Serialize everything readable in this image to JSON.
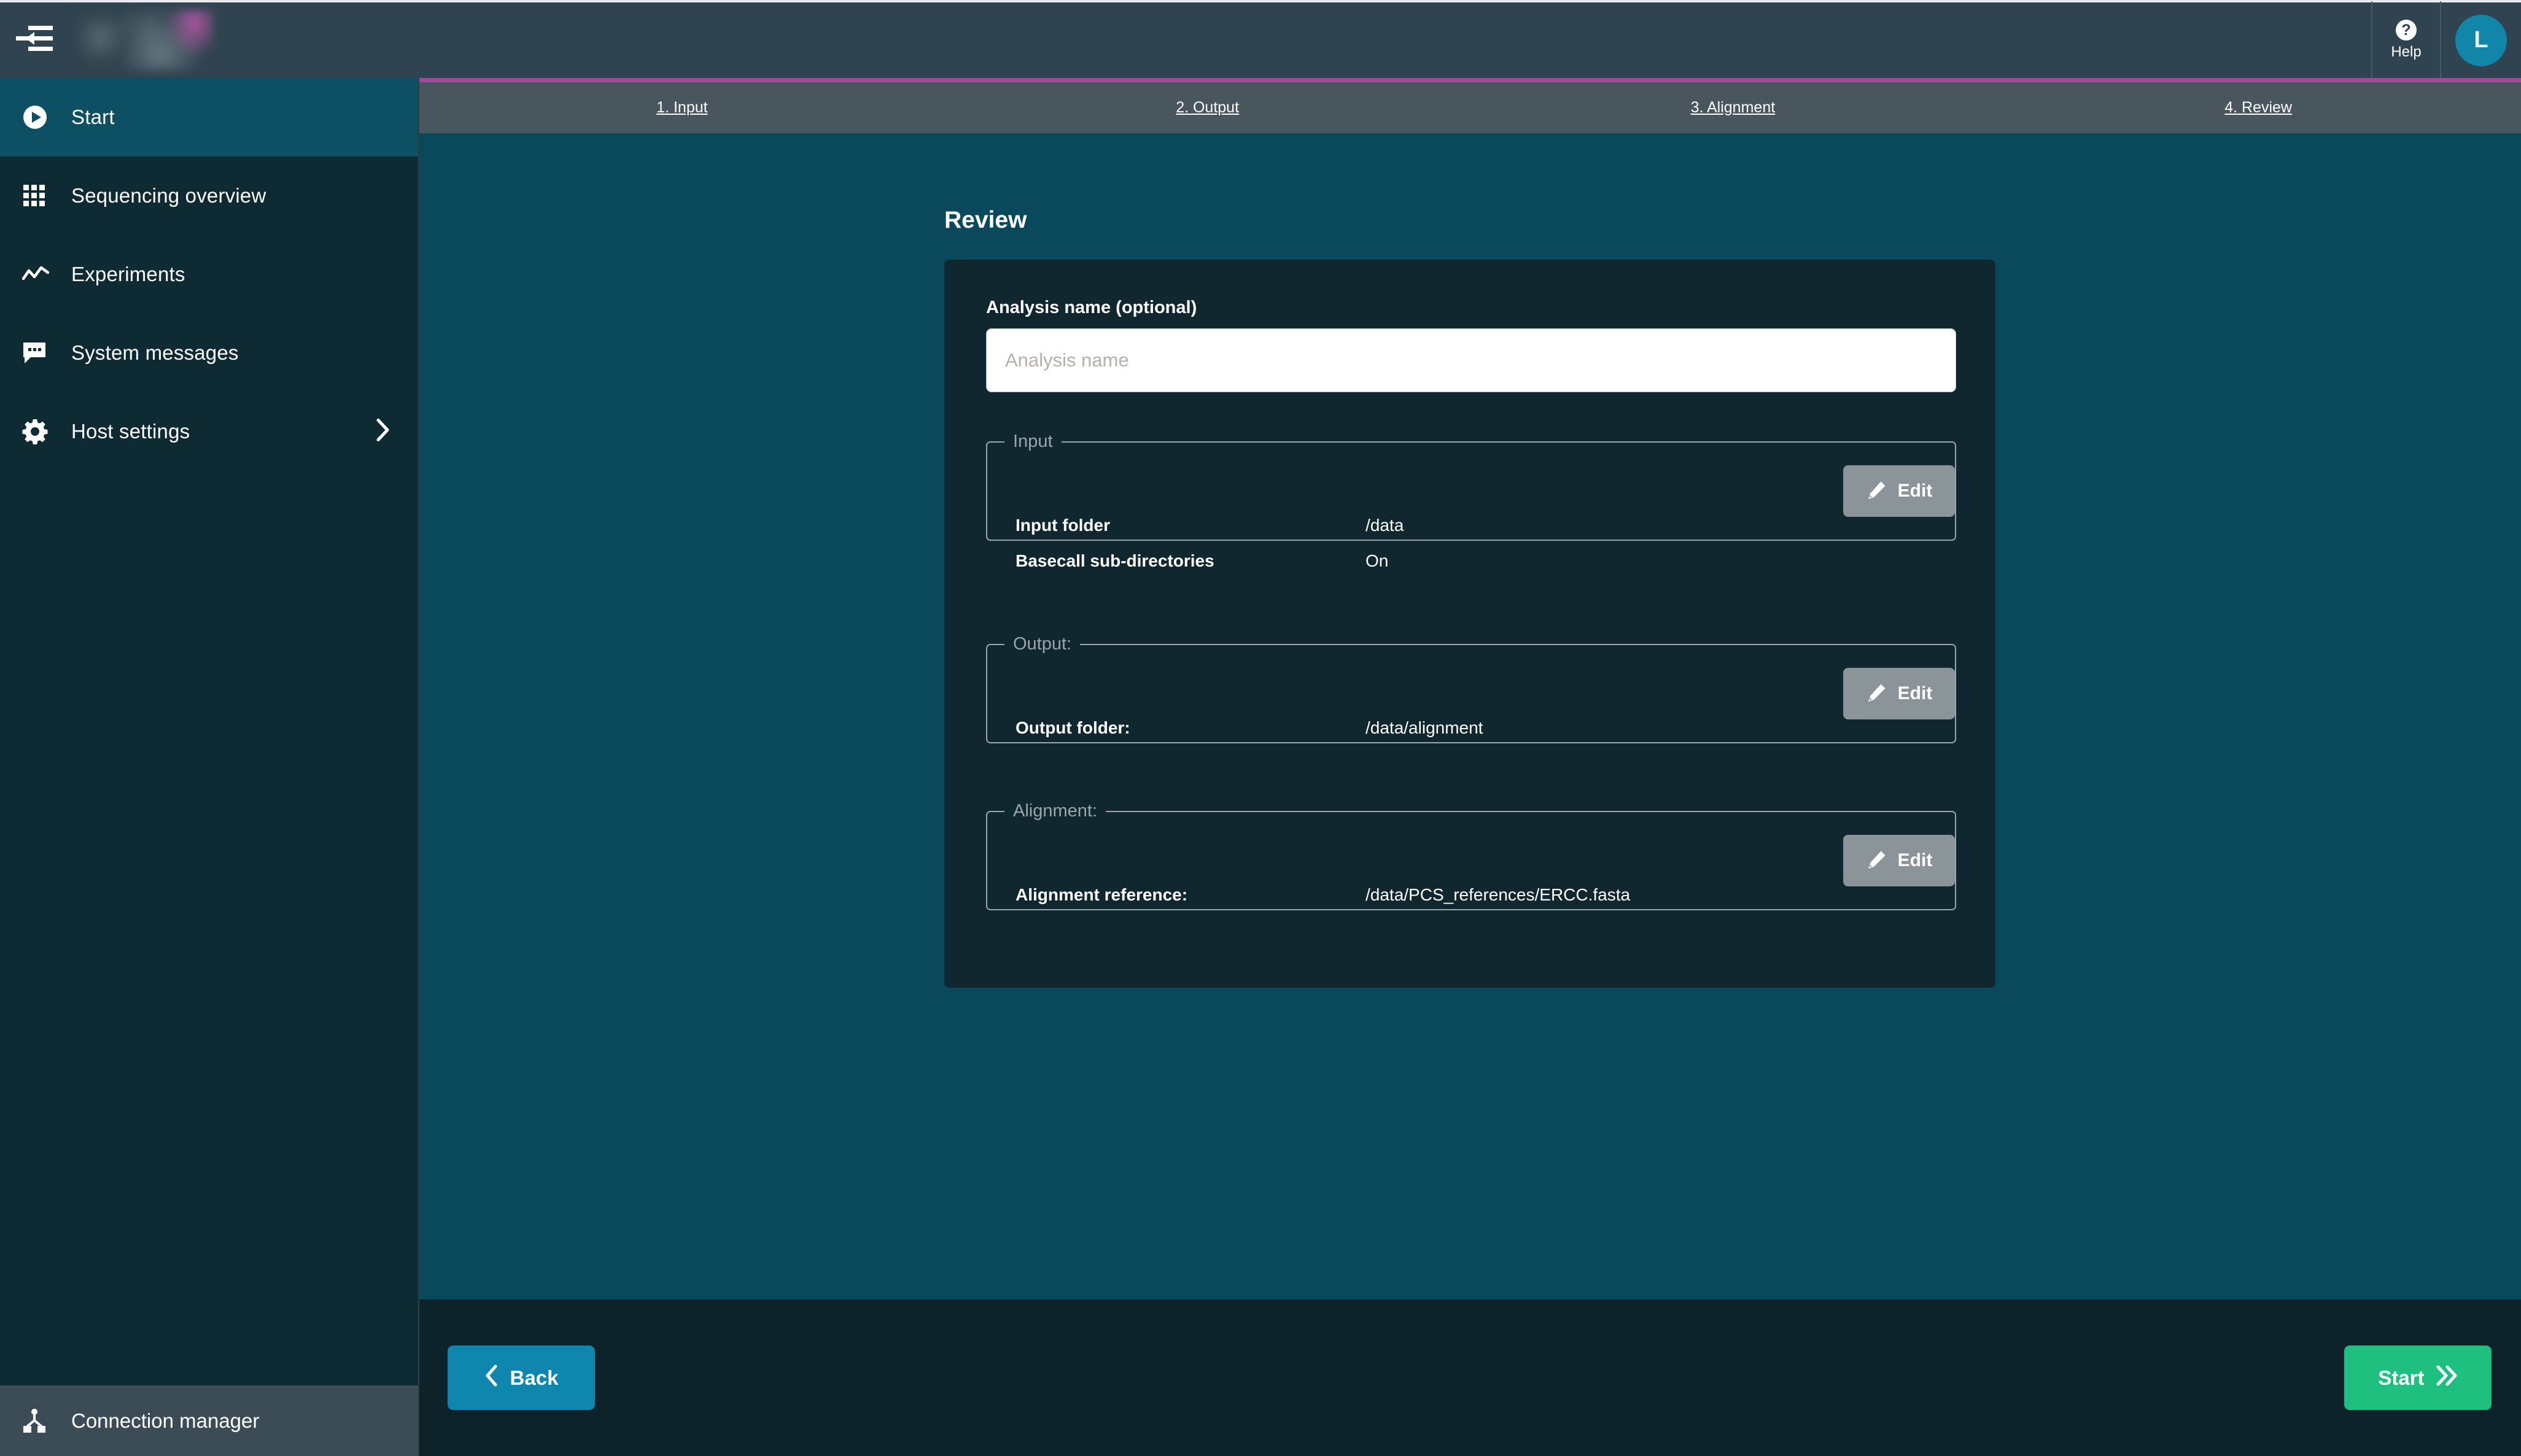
{
  "header": {
    "menu_toggle_name": "collapse-menu",
    "help_label": "Help",
    "help_glyph": "?",
    "avatar_initial": "L"
  },
  "sidebar": {
    "items": [
      {
        "label": "Start",
        "icon": "play-circle-icon",
        "active": true,
        "has_chevron": false
      },
      {
        "label": "Sequencing overview",
        "icon": "grid-icon",
        "active": false,
        "has_chevron": false
      },
      {
        "label": "Experiments",
        "icon": "line-chart-icon",
        "active": false,
        "has_chevron": false
      },
      {
        "label": "System messages",
        "icon": "chat-bubble-icon",
        "active": false,
        "has_chevron": false
      },
      {
        "label": "Host settings",
        "icon": "gear-icon",
        "active": false,
        "has_chevron": true
      }
    ],
    "connection_manager": {
      "label": "Connection manager",
      "icon": "network-nodes-icon"
    }
  },
  "tabs": [
    {
      "label": "1. Input"
    },
    {
      "label": "2. Output"
    },
    {
      "label": "3. Alignment"
    },
    {
      "label": "4. Review"
    }
  ],
  "main": {
    "page_title": "Review",
    "analysis_name": {
      "label": "Analysis name (optional)",
      "value": "",
      "placeholder": "Analysis name"
    },
    "sections": [
      {
        "legend": "Input",
        "edit_label": "Edit",
        "rows": [
          {
            "key": "Input folder",
            "value": "/data"
          },
          {
            "key": "Basecall sub-directories",
            "value": "On"
          }
        ]
      },
      {
        "legend": "Output:",
        "edit_label": "Edit",
        "rows": [
          {
            "key": "Output folder:",
            "value": "/data/alignment"
          }
        ]
      },
      {
        "legend": "Alignment:",
        "edit_label": "Edit",
        "rows": [
          {
            "key": "Alignment reference:",
            "value": "/data/PCS_references/ERCC.fasta"
          }
        ]
      }
    ]
  },
  "footer": {
    "back_label": "Back",
    "start_label": "Start"
  },
  "colors": {
    "header_bg": "#2f4450",
    "accent_magenta": "#a8469c",
    "tabbar_bg": "#49565e",
    "sidebar_bg": "#0e2a33",
    "sidebar_active": "#0e5063",
    "content_bg": "#09495b",
    "card_bg": "#10272f",
    "footer_bg": "#0d2229",
    "edit_btn": "#8a9499",
    "back_btn": "#0f86ad",
    "start_btn": "#1fbf7f",
    "avatar_bg": "#1186a8"
  }
}
